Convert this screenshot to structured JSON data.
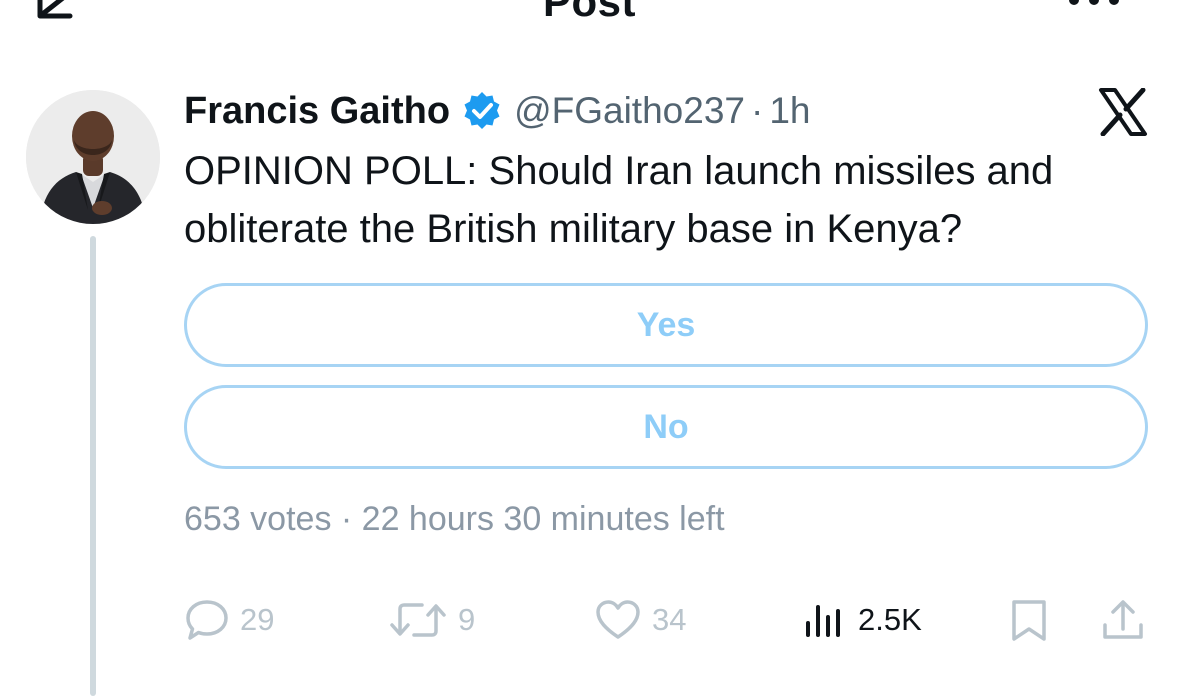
{
  "topbar": {
    "title": "Post",
    "back_icon": "arrow-left-icon",
    "more_icon": "more-horizontal-icon"
  },
  "post": {
    "author": {
      "name": "Francis Gaitho",
      "handle": "@FGaitho237",
      "verified": true,
      "avatar_icon": "avatar-photo"
    },
    "time_separator": "·",
    "time": "1h",
    "source_icon": "x-logo-icon",
    "text": "OPINION POLL: Should Iran launch missiles and obliterate the British military base in Kenya?",
    "poll": {
      "options": [
        {
          "label": "Yes"
        },
        {
          "label": "No"
        }
      ],
      "votes": "653 votes",
      "separator": "·",
      "time_left": "22 hours 30 minutes left",
      "meta_text": "653 votes · 22 hours 30 minutes left"
    },
    "actions": {
      "reply": {
        "icon": "reply-icon",
        "count": "29"
      },
      "repost": {
        "icon": "repost-icon",
        "count": "9"
      },
      "like": {
        "icon": "heart-icon",
        "count": "34"
      },
      "views": {
        "icon": "views-icon",
        "count": "2.5K"
      },
      "bookmark": {
        "icon": "bookmark-icon"
      },
      "share": {
        "icon": "share-icon"
      }
    }
  },
  "colors": {
    "text_primary": "#0f1419",
    "text_secondary": "#536471",
    "poll_border": "#a7d4f4",
    "poll_text": "#8ecdf8",
    "verified_blue": "#1d9bf0",
    "muted_actions": "#b9c4cc"
  }
}
